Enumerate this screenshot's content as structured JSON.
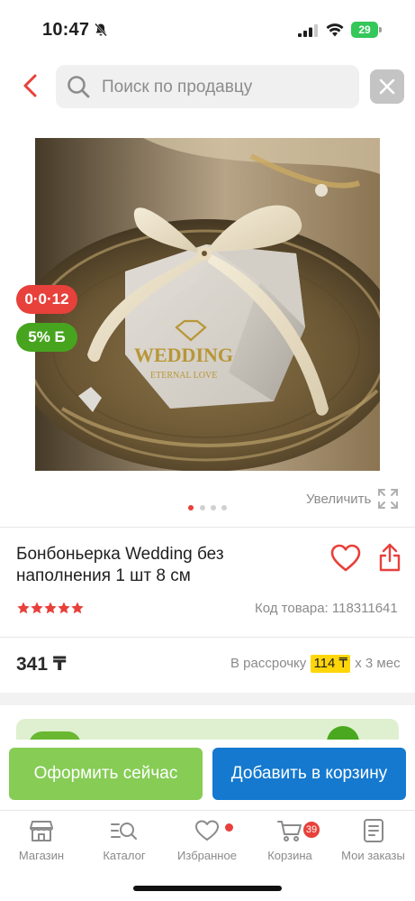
{
  "status_bar": {
    "time": "10:47",
    "battery": "29"
  },
  "header": {
    "search_placeholder": "Поиск по продавцу"
  },
  "product_image": {
    "box_text": "WEDDING",
    "box_subtext": "ETERNAL LOVE",
    "badge_installment": "0·0·12",
    "badge_bonus": "5% Б"
  },
  "gallery": {
    "total_dots": 4,
    "active_dot": 0,
    "zoom_label": "Увеличить"
  },
  "product": {
    "title": "Бонбоньерка Wedding без наполнения 1 шт 8 см",
    "rating": 5,
    "sku": "Код товара: 118311641",
    "price": "341 ₸",
    "installment_prefix": "В рассрочку",
    "installment_amount": "114 ₸",
    "installment_suffix": "x 3 мес"
  },
  "actions": {
    "buy_now": "Оформить сейчас",
    "add_to_cart": "Добавить в корзину"
  },
  "tabbar": {
    "items": [
      {
        "label": "Магазин",
        "icon": "shop-icon"
      },
      {
        "label": "Каталог",
        "icon": "catalog-search-icon"
      },
      {
        "label": "Избранное",
        "icon": "heart-icon"
      },
      {
        "label": "Корзина",
        "icon": "cart-icon",
        "badge": "39"
      },
      {
        "label": "Мои заказы",
        "icon": "orders-icon"
      }
    ]
  },
  "colors": {
    "accent_red": "#e8403a",
    "buy_green": "#86cc55",
    "cart_blue": "#1479cf",
    "highlight_yellow": "#ffd60a"
  }
}
